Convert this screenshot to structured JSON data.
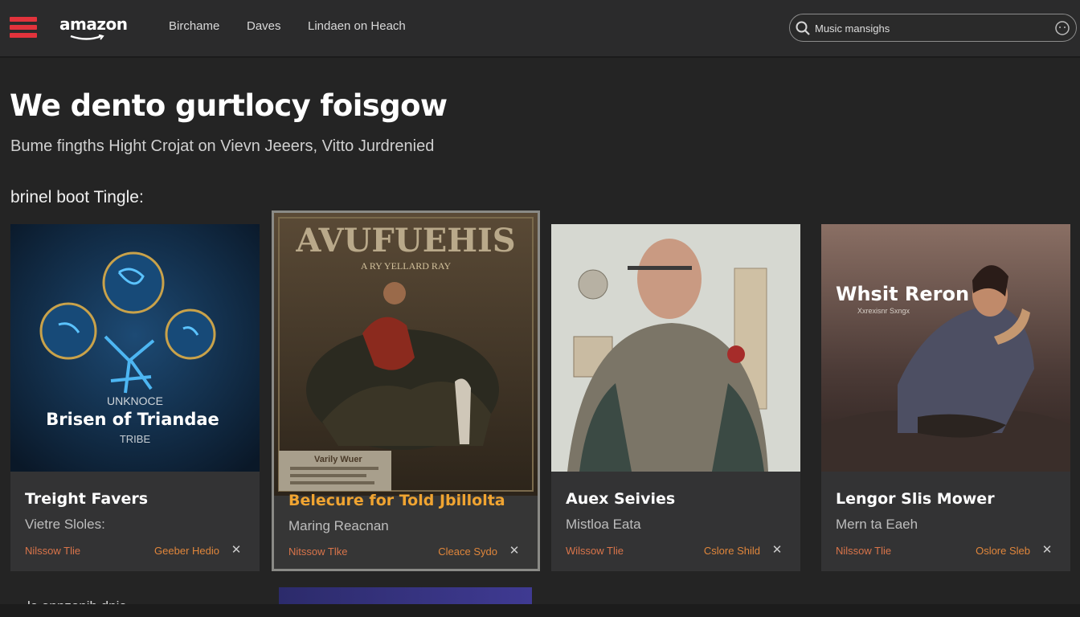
{
  "header": {
    "logo_text": "amazon",
    "nav": [
      "Birchame",
      "Daves",
      "Lindaen on Heach"
    ],
    "search": {
      "placeholder": "Music mansighs"
    }
  },
  "hero": {
    "title": "We dento gurtlocy foisgow",
    "subtitle": "Bume fingths Hight Crojat on Vievn Jeeers, Vitto Jurdrenied"
  },
  "section": {
    "label": "brinel boot Tingle:"
  },
  "cards": [
    {
      "cover_title": "Brisen of Triandae",
      "cover_top": "UNKNOCE",
      "cover_bottom": "TRIBE",
      "title": "Treight Favers",
      "subtitle": "Vietre Sloles:",
      "footer_left": "Nilssow Tlie",
      "footer_right": "Geeber Hedio",
      "colors": {
        "bg": "#0f2740",
        "glow": "#3aa6e8",
        "ring": "#c9a24a"
      }
    },
    {
      "cover_title": "AVUFUEHIS",
      "cover_sub": "A RY YELLARD RAY",
      "cover_note": "Varily Wuer",
      "title": "Belecure for Told Jbillolta",
      "subtitle": "Maring Reacnan",
      "footer_left": "Nitssow Tlke",
      "footer_right": "Cleace Sydo",
      "colors": {
        "title": "#f0a431",
        "bg": "#4a3a28"
      }
    },
    {
      "title": "Auex Seivies",
      "subtitle": "Mistloa Eata",
      "footer_left": "Wilssow Tlie",
      "footer_right": "Cslore Shild",
      "colors": {
        "bg": "#d9dbd4",
        "suit": "#7b7567"
      }
    },
    {
      "cover_title": "Whsit Reron",
      "cover_sub": "Xxrexisnr Sxngx",
      "title": "Lengor Slis Mower",
      "subtitle": "Mern ta Eaeh",
      "footer_left": "Nilssow Tlie",
      "footer_right": "Oslore Sleb",
      "colors": {
        "bg": "#4b3a36",
        "sky": "#8a6f64"
      }
    }
  ],
  "lower": {
    "label": "le annzonib dnia"
  }
}
